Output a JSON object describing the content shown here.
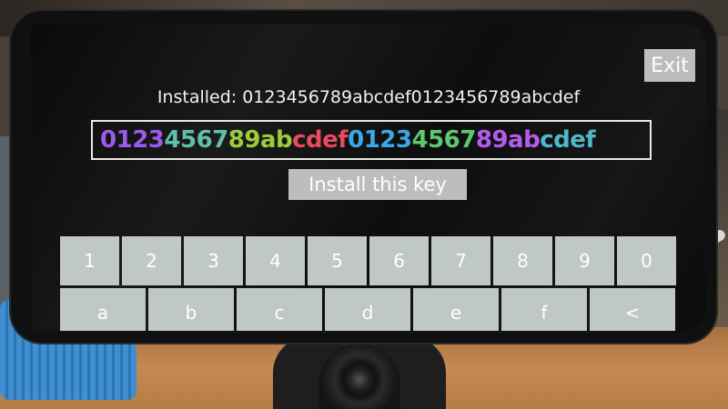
{
  "app": {
    "exit_label": "Exit",
    "installed_text": "Installed: 0123456789abcdef0123456789abcdef",
    "install_button_label": "Install this key"
  },
  "key_input": {
    "value": "0123456789abcdef0123456789abcdef",
    "char_colors": [
      "#9b59f0",
      "#9b59f0",
      "#9b59f0",
      "#9b59f0",
      "#5cc1a8",
      "#5cc1a8",
      "#5cc1a8",
      "#5cc1a8",
      "#9ccc3a",
      "#9ccc3a",
      "#9ccc3a",
      "#9ccc3a",
      "#e84a5f",
      "#e84a5f",
      "#e84a5f",
      "#e84a5f",
      "#3aa8e8",
      "#3aa8e8",
      "#3aa8e8",
      "#3aa8e8",
      "#5cc870",
      "#5cc870",
      "#5cc870",
      "#5cc870",
      "#b45cf0",
      "#b45cf0",
      "#b45cf0",
      "#b45cf0",
      "#4fb8c8",
      "#4fb8c8",
      "#4fb8c8",
      "#4fb8c8"
    ]
  },
  "keyboard": {
    "row1": [
      "1",
      "2",
      "3",
      "4",
      "5",
      "6",
      "7",
      "8",
      "9",
      "0"
    ],
    "row2": [
      "a",
      "b",
      "c",
      "d",
      "e",
      "f",
      "<"
    ]
  },
  "colors": {
    "button_bg": "#bdbdbd",
    "key_bg": "#bfc8c6",
    "screen_bg": "#0a0a0a"
  }
}
